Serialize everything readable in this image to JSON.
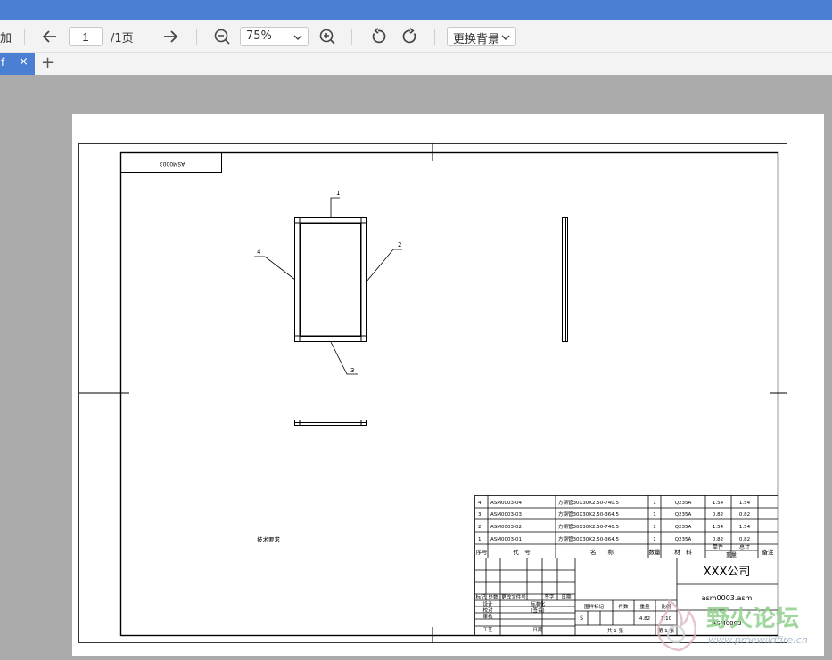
{
  "toolbar": {
    "left_fragment": "加",
    "page_value": "1",
    "page_total": "/1页",
    "zoom_value": "75%",
    "background_label": "更换背景"
  },
  "tab": {
    "label_fragment": "f",
    "close_symbol": "×",
    "add_symbol": "+"
  },
  "drawing": {
    "code_box": "ASM0003",
    "balloons": [
      "1",
      "2",
      "3",
      "4"
    ],
    "tech_requirements": "技术要求",
    "bom_rows": [
      {
        "seq": "4",
        "code": "ASM0003-04",
        "name": "方钢管30X30X2.50-740.5",
        "qty": "1",
        "material": "Q235A",
        "unit_wt": "1.54",
        "total_wt": "1.54"
      },
      {
        "seq": "3",
        "code": "ASM0003-03",
        "name": "方钢管30X30X2.50-364.5",
        "qty": "1",
        "material": "Q235A",
        "unit_wt": "0.82",
        "total_wt": "0.82"
      },
      {
        "seq": "2",
        "code": "ASM0003-02",
        "name": "方钢管30X30X2.50-740.5",
        "qty": "1",
        "material": "Q235A",
        "unit_wt": "1.54",
        "total_wt": "1.54"
      },
      {
        "seq": "1",
        "code": "ASM0003-01",
        "name": "方钢管30X30X2.50-364.5",
        "qty": "1",
        "material": "Q235A",
        "unit_wt": "0.82",
        "total_wt": "0.82"
      }
    ],
    "bom_header": {
      "seq": "序号",
      "code": "代　号",
      "name": "名　　称",
      "qty": "数量",
      "material": "材　料",
      "unit": "单件",
      "total": "总计",
      "weight": "重量",
      "remark": "备注"
    },
    "title_block": {
      "company": "XXX公司",
      "file_name": "asm0003.asm",
      "drawing_no": "ASM0003",
      "rev_headers": [
        "标记",
        "处数",
        "更改文件号",
        "签字",
        "日期"
      ],
      "roles": [
        "设计",
        "校对",
        "审核",
        "工艺"
      ],
      "std_label": "标准化",
      "sign_label": "(签名)",
      "date_label": "日期",
      "stage_label": "图样标记",
      "pieces_label": "件数",
      "weight_label": "重量",
      "scale_label": "比例",
      "stage_value": "S",
      "weight_value": "4.82",
      "scale_value": "1:10",
      "sheets_total": "共 1 张",
      "sheet_no": "第 1 张"
    }
  },
  "watermark": {
    "title": "野火论坛",
    "url": "www.proewildfire.cn"
  }
}
